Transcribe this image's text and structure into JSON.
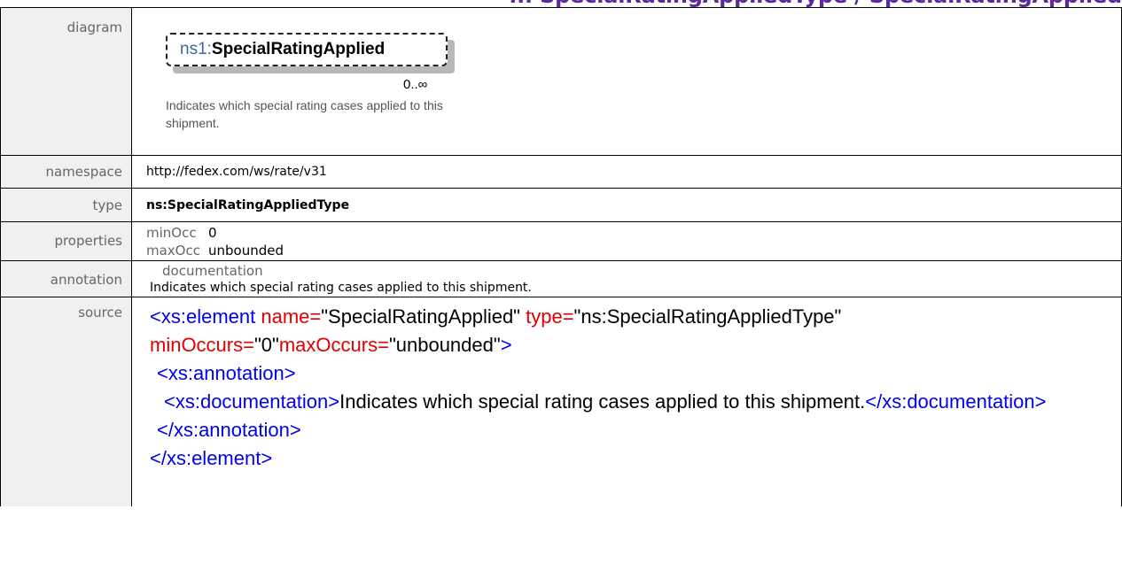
{
  "title": "... SpecialRatingAppliedType / SpecialRatingApplied",
  "rows": {
    "diagram": {
      "label": "diagram",
      "element_prefix": "ns1:",
      "element_name": "SpecialRatingApplied",
      "cardinality": "0..∞",
      "description": "Indicates which special rating cases applied to this shipment."
    },
    "namespace": {
      "label": "namespace",
      "value": "http://fedex.com/ws/rate/v31"
    },
    "type": {
      "label": "type",
      "value": "ns:SpecialRatingAppliedType"
    },
    "properties": {
      "label": "properties",
      "items": [
        {
          "key": "minOcc",
          "value": "0"
        },
        {
          "key": "maxOcc",
          "value": "unbounded"
        }
      ]
    },
    "annotation": {
      "label": "annotation",
      "heading": "documentation",
      "text": "Indicates which  special rating cases applied to this shipment."
    },
    "source": {
      "label": "source",
      "lines": {
        "l1_tag": "<xs:element",
        "l1_attr1": " name=",
        "l1_val1": "\"SpecialRatingApplied\"",
        "l1_attr2": " type=",
        "l1_val2": "\"ns:SpecialRatingAppliedType\"",
        "l2_attr1": "minOccurs=",
        "l2_val1": "\"0\"",
        "l2_attr2": "maxOccurs=",
        "l2_val2": "\"unbounded\"",
        "l2_close": ">",
        "l3": "<xs:annotation>",
        "l4_open": "<xs:documentation>",
        "l4_text": "Indicates which special rating cases applied to this shipment.",
        "l4_close": "</xs:documentation>",
        "l5": "</xs:annotation>",
        "l6": "</xs:element>"
      }
    }
  }
}
